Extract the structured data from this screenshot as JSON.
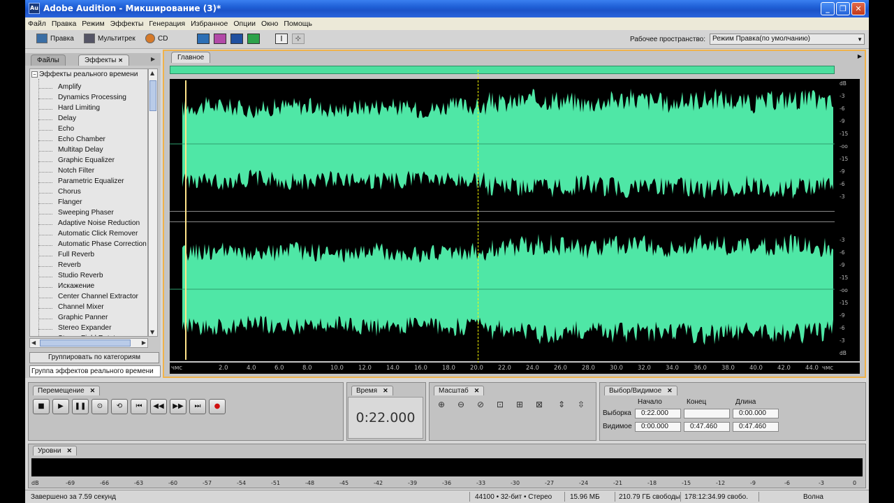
{
  "window": {
    "title": "Adobe Audition - Микширование (3)*",
    "icon": "Au"
  },
  "menu": [
    "Файл",
    "Правка",
    "Режим",
    "Эффекты",
    "Генерация",
    "Избранное",
    "Опции",
    "Окно",
    "Помощь"
  ],
  "toolbar": {
    "edit_label": "Правка",
    "multitrack_label": "Мультитрек",
    "cd_label": "CD",
    "workspace_label": "Рабочее пространство:",
    "workspace_value": "Режим Правка(по умолчанию)"
  },
  "left_panel": {
    "tabs": [
      "Файлы",
      "Эффекты"
    ],
    "root": "Эффекты реального времени",
    "items": [
      "Amplify",
      "Dynamics Processing",
      "Hard Limiting",
      "Delay",
      "Echo",
      "Echo Chamber",
      "Multitap Delay",
      "Graphic Equalizer",
      "Notch Filter",
      "Parametric Equalizer",
      "Chorus",
      "Flanger",
      "Sweeping Phaser",
      "Adaptive Noise Reduction",
      "Automatic Click Remover",
      "Automatic Phase Correction",
      "Full Reverb",
      "Reverb",
      "Studio Reverb",
      "Искажение",
      "Center Channel Extractor",
      "Channel Mixer",
      "Graphic Panner",
      "Stereo Expander",
      "Stereo Field Rotate"
    ],
    "group_button": "Группировать по категориям",
    "group_field": "Группа эффектов реального времени"
  },
  "main_panel": {
    "tab": "Главное",
    "db_labels": [
      "dB",
      "-3",
      "-6",
      "-9",
      "-15",
      "-оо",
      "-15",
      "-9",
      "-6",
      "-3"
    ],
    "db_labels_bottom": [
      "-3",
      "-6",
      "-9",
      "-15",
      "-оо",
      "-15",
      "-9",
      "-6",
      "-3",
      "dB"
    ],
    "time_labels": [
      "чмс",
      "2.0",
      "4.0",
      "6.0",
      "8.0",
      "10.0",
      "12.0",
      "14.0",
      "16.0",
      "18.0",
      "20.0",
      "22.0",
      "24.0",
      "26.0",
      "28.0",
      "30.0",
      "32.0",
      "34.0",
      "36.0",
      "38.0",
      "40.0",
      "42.0",
      "44.0",
      "чмс"
    ],
    "wave_color": "#4fe7a6"
  },
  "transport": {
    "title": "Перемещение"
  },
  "time_panel": {
    "title": "Время",
    "value": "0:22.000"
  },
  "zoom_panel": {
    "title": "Масштаб"
  },
  "selection_panel": {
    "title": "Выбор/Видимое",
    "col_start": "Начало",
    "col_end": "Конец",
    "col_length": "Длина",
    "row_selection": "Выборка",
    "row_view": "Видимое",
    "sel_start": "0:22.000",
    "sel_end": "",
    "sel_length": "0:00.000",
    "view_start": "0:00.000",
    "view_end": "0:47.460",
    "view_length": "0:47.460"
  },
  "levels": {
    "title": "Уровни",
    "scale": [
      "dB",
      "-69",
      "-66",
      "-63",
      "-60",
      "-57",
      "-54",
      "-51",
      "-48",
      "-45",
      "-42",
      "-39",
      "-36",
      "-33",
      "-30",
      "-27",
      "-24",
      "-21",
      "-18",
      "-15",
      "-12",
      "-9",
      "-6",
      "-3",
      "0"
    ]
  },
  "status": {
    "left": "Завершено за 7.59 секунд",
    "format": "44100 • 32-бит • Стерео",
    "size": "15.96 МБ",
    "free": "210.79 ГБ свободы",
    "free_time": "178:12:34.99 свобо.",
    "mode": "Волна"
  }
}
